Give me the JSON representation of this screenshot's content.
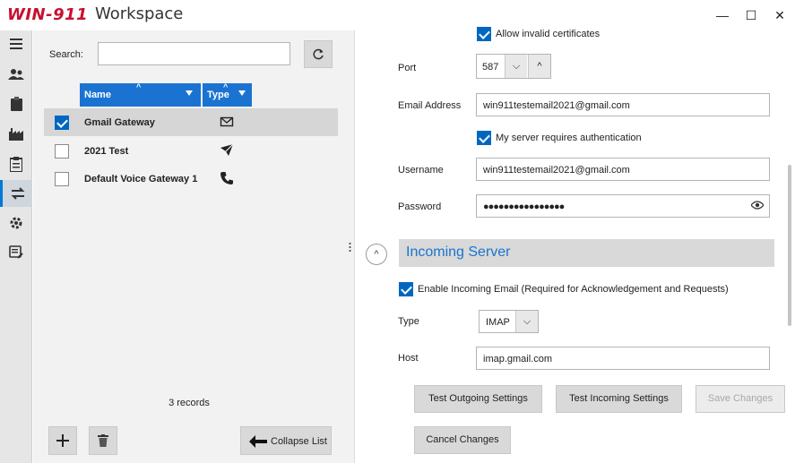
{
  "window": {
    "logo": "WIN-911",
    "title": "Workspace",
    "controls": {
      "minimize": "—",
      "maximize": "☐",
      "close": "✕"
    }
  },
  "rail": {
    "items": [
      {
        "icon": "menu-icon"
      },
      {
        "icon": "users-icon"
      },
      {
        "icon": "clipboard-icon"
      },
      {
        "icon": "factory-icon"
      },
      {
        "icon": "report-icon"
      },
      {
        "icon": "gateway-icon",
        "active": true
      },
      {
        "icon": "gear-icon"
      },
      {
        "icon": "notes-icon"
      }
    ]
  },
  "list": {
    "search_label": "Search:",
    "search_value": "",
    "columns": {
      "name": "Name",
      "type": "Type"
    },
    "rows": [
      {
        "name": "Gmail Gateway",
        "type_icon": "email-icon",
        "checked": true
      },
      {
        "name": "2021 Test",
        "type_icon": "telegram-icon",
        "checked": false
      },
      {
        "name": "Default Voice Gateway 1",
        "type_icon": "phone-icon",
        "checked": false
      }
    ],
    "records": "3 records",
    "collapse_label": "Collapse List"
  },
  "form": {
    "allow_invalid_certs_label": "Allow invalid certificates",
    "port_label": "Port",
    "port_value": "587",
    "email_label": "Email Address",
    "email_value": "win911testemail2021@gmail.com",
    "auth_label": "My server requires authentication",
    "username_label": "Username",
    "username_value": "win911testemail2021@gmail.com",
    "password_label": "Password",
    "password_value": "●●●●●●●●●●●●●●●●",
    "incoming_section": "Incoming Server",
    "enable_incoming_label": "Enable Incoming Email (Required for Acknowledgement and Requests)",
    "type_label": "Type",
    "type_value": "IMAP",
    "host_label": "Host",
    "host_value": "imap.gmail.com",
    "buttons": {
      "test_outgoing": "Test Outgoing Settings",
      "test_incoming": "Test Incoming Settings",
      "save": "Save Changes",
      "cancel": "Cancel Changes"
    }
  },
  "colors": {
    "accent": "#1a73d1",
    "brand": "#c8102e",
    "checkbox": "#0067c0"
  }
}
